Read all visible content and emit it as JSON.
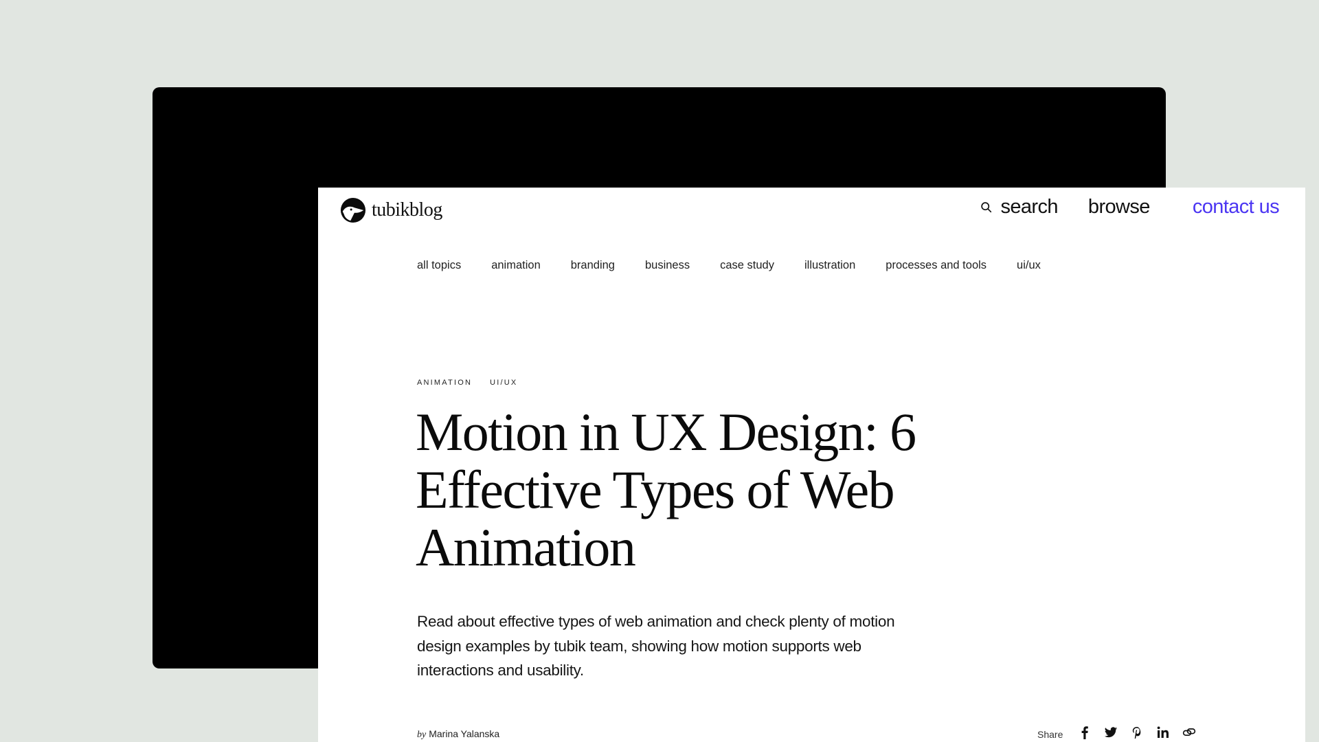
{
  "site": {
    "logo_text": "tubikblog"
  },
  "topnav": {
    "search_label": "search",
    "browse_label": "browse",
    "contact_label": "contact us",
    "accent_color": "#4b35f2"
  },
  "categories": [
    {
      "label": "all topics"
    },
    {
      "label": "animation"
    },
    {
      "label": "branding"
    },
    {
      "label": "business"
    },
    {
      "label": "case study"
    },
    {
      "label": "illustration"
    },
    {
      "label": "processes and tools"
    },
    {
      "label": "ui/ux"
    }
  ],
  "article": {
    "tags": [
      "ANIMATION",
      "UI/UX"
    ],
    "title": "Motion in UX Design: 6 Effective Types of Web Animation",
    "lede": "Read about effective types of web animation and check plenty of motion design examples by tubik team, showing how motion supports web interactions and usability.",
    "byline_prefix": "by",
    "author": "Marina Yalanska"
  },
  "share": {
    "label": "Share",
    "icons": [
      "facebook-icon",
      "twitter-icon",
      "pinterest-icon",
      "linkedin-icon",
      "link-icon"
    ]
  }
}
